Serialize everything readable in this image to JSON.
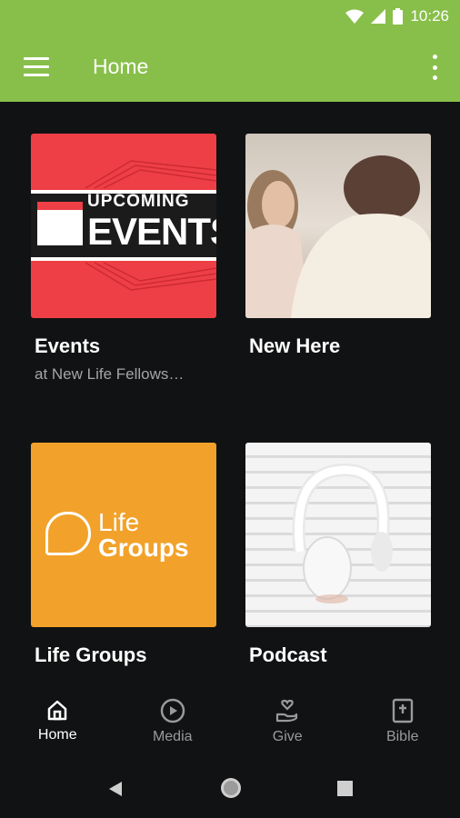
{
  "status": {
    "time": "10:26"
  },
  "appbar": {
    "title": "Home"
  },
  "cards": [
    {
      "title": "Events",
      "subtitle": "at New Life Fellows…",
      "thumb_text_1": "UPCOMING",
      "thumb_text_2": "EVENTS"
    },
    {
      "title": "New Here",
      "subtitle": ""
    },
    {
      "title": "Life Groups",
      "subtitle": "",
      "thumb_text_1": "Life",
      "thumb_text_2": "Groups"
    },
    {
      "title": "Podcast",
      "subtitle": ""
    }
  ],
  "bottom_nav": [
    {
      "label": "Home",
      "icon": "home-icon",
      "active": true
    },
    {
      "label": "Media",
      "icon": "play-circle-icon",
      "active": false
    },
    {
      "label": "Give",
      "icon": "give-icon",
      "active": false
    },
    {
      "label": "Bible",
      "icon": "bible-icon",
      "active": false
    }
  ],
  "colors": {
    "accent": "#88bf4a",
    "background": "#111213",
    "events_red": "#ee3f46",
    "lifegroups_orange": "#f2a22a"
  }
}
